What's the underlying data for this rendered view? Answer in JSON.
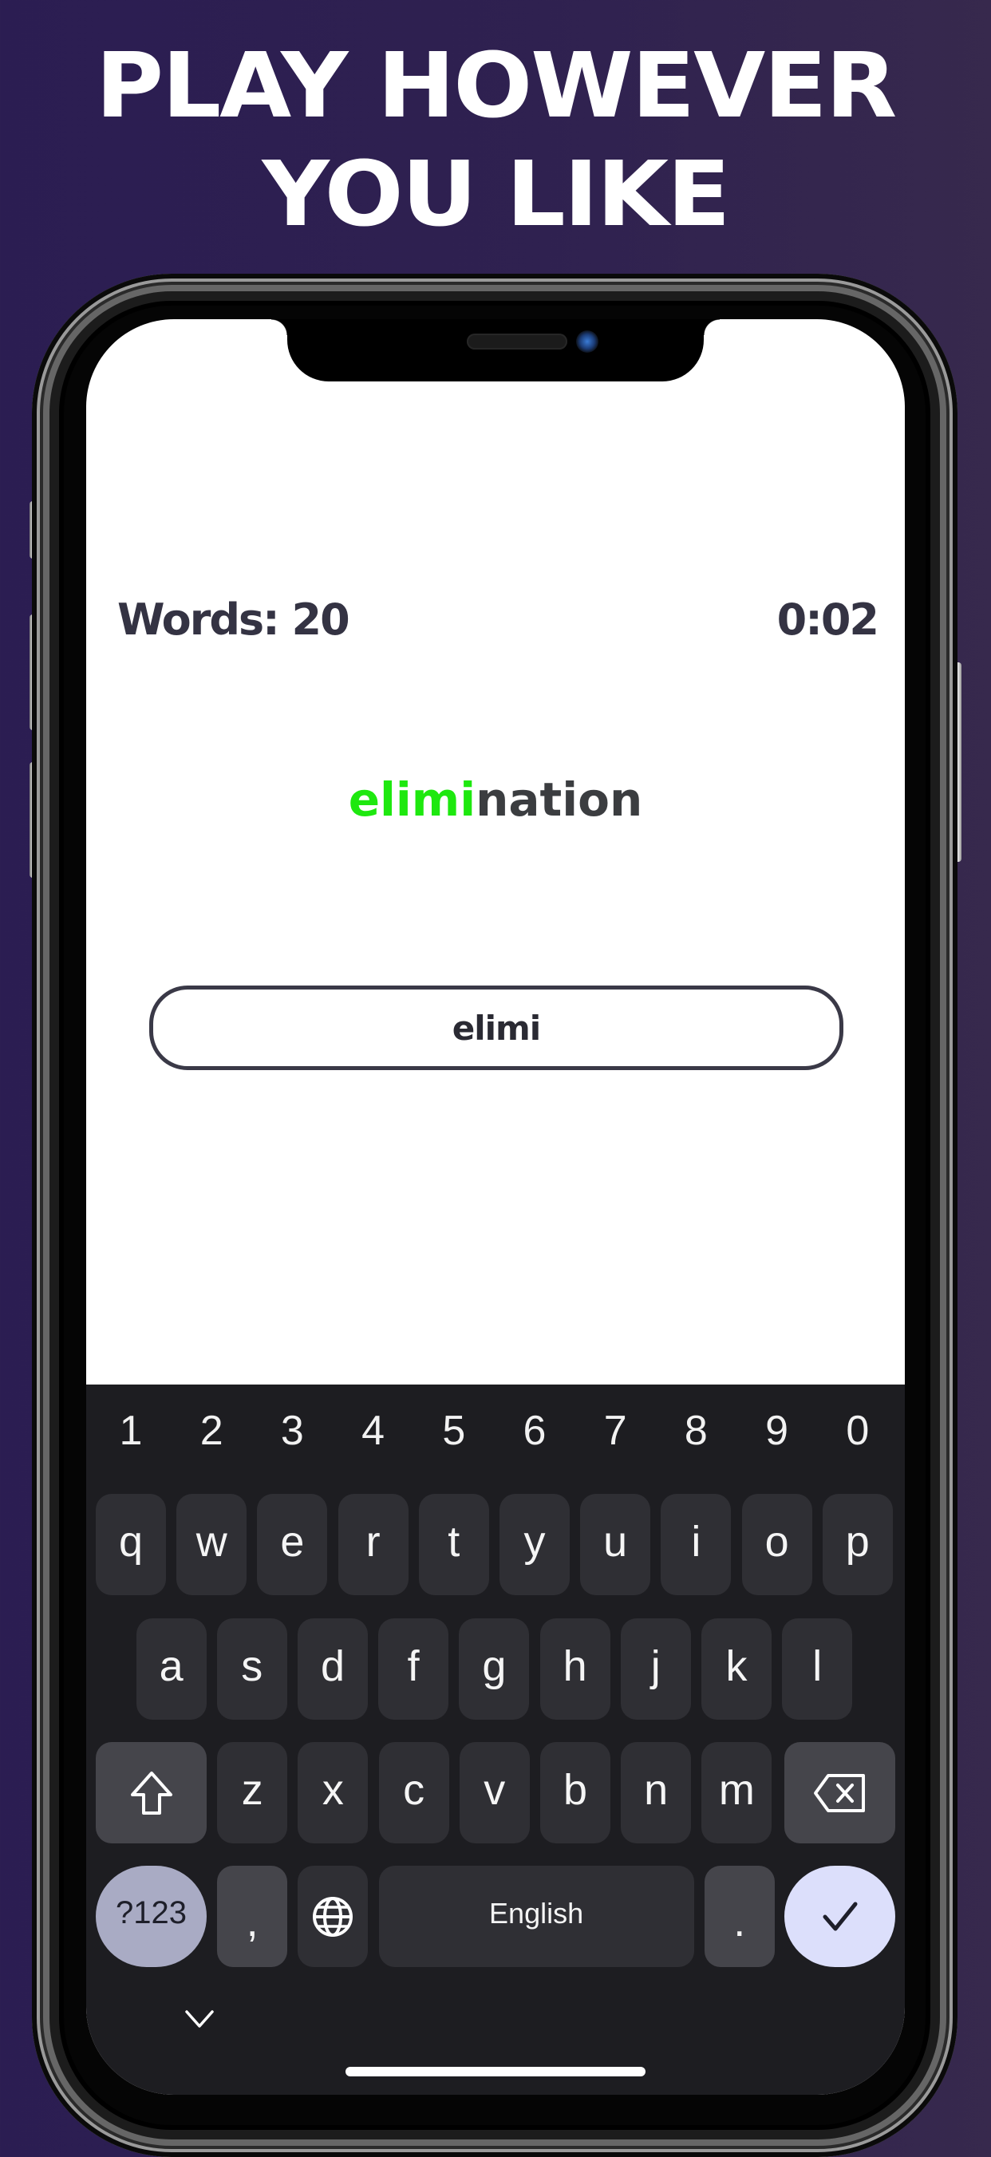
{
  "promo": {
    "headline_line1": "PLAY HOWEVER",
    "headline_line2": "YOU LIKE",
    "background_color": "#2d1f50"
  },
  "game": {
    "words_label": "Words: 20",
    "timer": "0:02",
    "target_word": {
      "typed_part": "elimi",
      "remaining_part": "nation",
      "typed_color": "#1ee80f",
      "remaining_color": "#3b3d40"
    },
    "input_value": "elimi"
  },
  "keyboard": {
    "number_row": [
      "1",
      "2",
      "3",
      "4",
      "5",
      "6",
      "7",
      "8",
      "9",
      "0"
    ],
    "row1": [
      "q",
      "w",
      "e",
      "r",
      "t",
      "y",
      "u",
      "i",
      "o",
      "p"
    ],
    "row2": [
      "a",
      "s",
      "d",
      "f",
      "g",
      "h",
      "j",
      "k",
      "l"
    ],
    "row3": [
      "z",
      "x",
      "c",
      "v",
      "b",
      "n",
      "m"
    ],
    "shift_icon": "shift-arrow-icon",
    "backspace_icon": "backspace-icon",
    "symbols_label": "?123",
    "comma_label": ",",
    "globe_icon": "globe-icon",
    "space_label": "English",
    "period_label": ".",
    "enter_icon": "checkmark-icon",
    "collapse_icon": "chevron-down-icon"
  }
}
